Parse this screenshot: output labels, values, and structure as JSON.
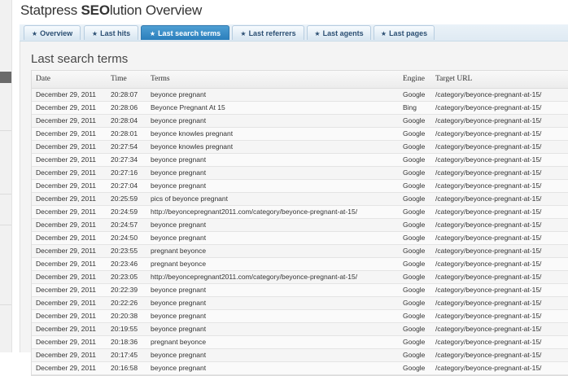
{
  "header": {
    "title_prefix": "Statpress ",
    "title_bold": "SEO",
    "title_suffix": "lution Overview"
  },
  "tabs": [
    {
      "label": "Overview",
      "active": false
    },
    {
      "label": "Last hits",
      "active": false
    },
    {
      "label": "Last search terms",
      "active": true
    },
    {
      "label": "Last referrers",
      "active": false
    },
    {
      "label": "Last agents",
      "active": false
    },
    {
      "label": "Last pages",
      "active": false
    }
  ],
  "section": {
    "title": "Last search terms"
  },
  "table": {
    "columns": [
      "Date",
      "Time",
      "Terms",
      "Engine",
      "Target URL"
    ],
    "rows": [
      [
        "December 29, 2011",
        "20:28:07",
        "beyonce pregnant",
        "Google",
        "/category/beyonce-pregnant-at-15/"
      ],
      [
        "December 29, 2011",
        "20:28:06",
        "Beyonce Pregnant At 15",
        "Bing",
        "/category/beyonce-pregnant-at-15/"
      ],
      [
        "December 29, 2011",
        "20:28:04",
        "beyonce pregnant",
        "Google",
        "/category/beyonce-pregnant-at-15/"
      ],
      [
        "December 29, 2011",
        "20:28:01",
        "beyonce knowles pregnant",
        "Google",
        "/category/beyonce-pregnant-at-15/"
      ],
      [
        "December 29, 2011",
        "20:27:54",
        "beyonce knowles pregnant",
        "Google",
        "/category/beyonce-pregnant-at-15/"
      ],
      [
        "December 29, 2011",
        "20:27:34",
        "beyonce pregnant",
        "Google",
        "/category/beyonce-pregnant-at-15/"
      ],
      [
        "December 29, 2011",
        "20:27:16",
        "beyonce pregnant",
        "Google",
        "/category/beyonce-pregnant-at-15/"
      ],
      [
        "December 29, 2011",
        "20:27:04",
        "beyonce pregnant",
        "Google",
        "/category/beyonce-pregnant-at-15/"
      ],
      [
        "December 29, 2011",
        "20:25:59",
        "pics of beyonce pregnant",
        "Google",
        "/category/beyonce-pregnant-at-15/"
      ],
      [
        "December 29, 2011",
        "20:24:59",
        "http://beyoncepregnant2011.com/category/beyonce-pregnant-at-15/",
        "Google",
        "/category/beyonce-pregnant-at-15/"
      ],
      [
        "December 29, 2011",
        "20:24:57",
        "beyonce pregnant",
        "Google",
        "/category/beyonce-pregnant-at-15/"
      ],
      [
        "December 29, 2011",
        "20:24:50",
        "beyonce pregnant",
        "Google",
        "/category/beyonce-pregnant-at-15/"
      ],
      [
        "December 29, 2011",
        "20:23:55",
        "pregnant beyonce",
        "Google",
        "/category/beyonce-pregnant-at-15/"
      ],
      [
        "December 29, 2011",
        "20:23:46",
        "pregnant beyonce",
        "Google",
        "/category/beyonce-pregnant-at-15/"
      ],
      [
        "December 29, 2011",
        "20:23:05",
        "http://beyoncepregnant2011.com/category/beyonce-pregnant-at-15/",
        "Google",
        "/category/beyonce-pregnant-at-15/"
      ],
      [
        "December 29, 2011",
        "20:22:39",
        "beyonce pregnant",
        "Google",
        "/category/beyonce-pregnant-at-15/"
      ],
      [
        "December 29, 2011",
        "20:22:26",
        "beyonce pregnant",
        "Google",
        "/category/beyonce-pregnant-at-15/"
      ],
      [
        "December 29, 2011",
        "20:20:38",
        "beyonce pregnant",
        "Google",
        "/category/beyonce-pregnant-at-15/"
      ],
      [
        "December 29, 2011",
        "20:19:55",
        "beyonce pregnant",
        "Google",
        "/category/beyonce-pregnant-at-15/"
      ],
      [
        "December 29, 2011",
        "20:18:36",
        "pregnant beyonce",
        "Google",
        "/category/beyonce-pregnant-at-15/"
      ],
      [
        "December 29, 2011",
        "20:17:45",
        "beyonce pregnant",
        "Google",
        "/category/beyonce-pregnant-at-15/"
      ],
      [
        "December 29, 2011",
        "20:16:58",
        "beyonce pregnant",
        "Google",
        "/category/beyonce-pregnant-at-15/"
      ]
    ]
  },
  "colors": {
    "active_tab": "#2a7ebc",
    "tab_text": "#2c4f73",
    "panel_bg": "#f4f4f4"
  },
  "icons": {
    "tab_marker": "star-icon"
  }
}
